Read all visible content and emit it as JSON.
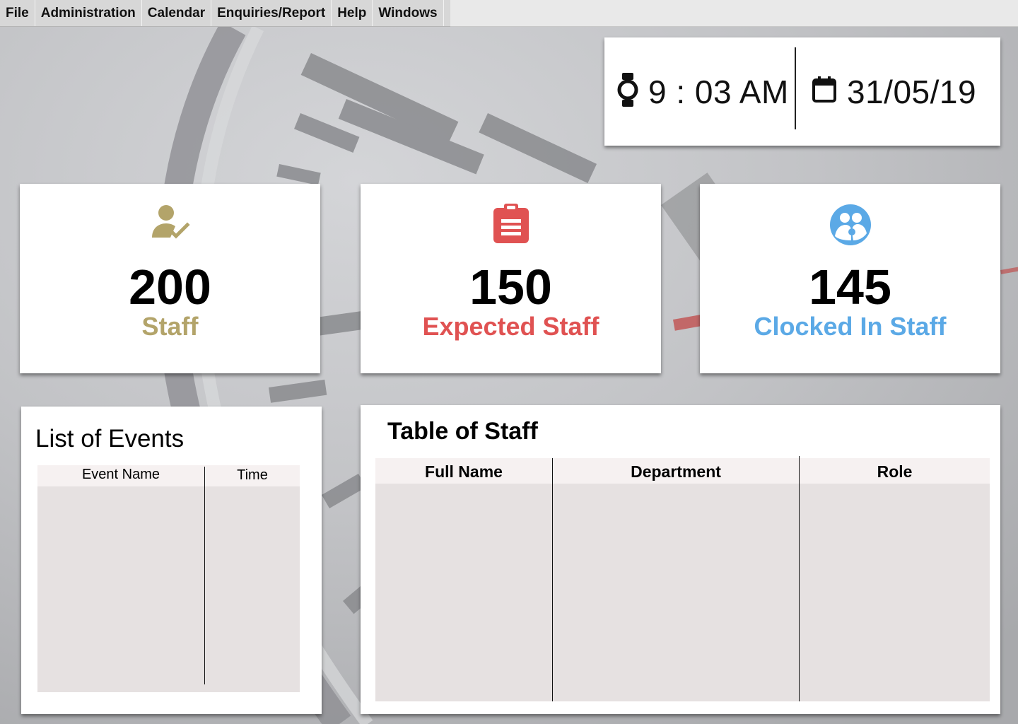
{
  "menu": {
    "items": [
      "File",
      "Administration",
      "Calendar",
      "Enquiries/Report",
      "Help",
      "Windows"
    ]
  },
  "clock": {
    "time": "9 : 03 AM",
    "date": "31/05/19",
    "time_icon": "watch-icon",
    "date_icon": "calendar-icon"
  },
  "stats": [
    {
      "value": "200",
      "label": "Staff",
      "color": "#b3a46a",
      "icon": "person-check-icon"
    },
    {
      "value": "150",
      "label": "Expected Staff",
      "color": "#e05252",
      "icon": "clipboard-icon"
    },
    {
      "value": "145",
      "label": "Clocked In Staff",
      "color": "#5ba9e6",
      "icon": "group-icon"
    }
  ],
  "events": {
    "title": "List of Events",
    "columns": [
      "Event Name",
      "Time"
    ],
    "rows": []
  },
  "staff_table": {
    "title": "Table of Staff",
    "columns": [
      "Full Name",
      "Department",
      "Role"
    ],
    "rows": []
  },
  "colors": {
    "table_header": "#f6f1f1",
    "table_body": "#e6e1e1"
  }
}
